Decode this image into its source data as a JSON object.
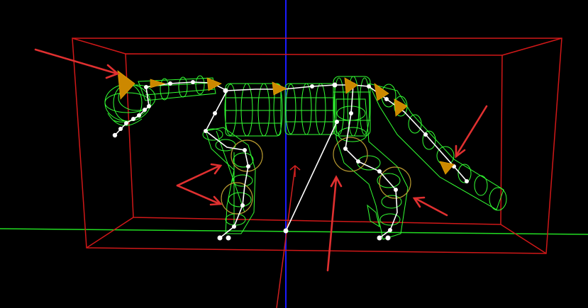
{
  "viewport": {
    "background": "#000000",
    "axis_colors": {
      "x": "#22dd22",
      "y": "#d02020",
      "z": "#1a1aff"
    },
    "bounding_box_color": "#d01818",
    "mesh_color": "#33ff33",
    "bone_color": "#ffffff",
    "joint_ring_color": "#b89a30",
    "cone_handle_color": "#cc8800",
    "annotation_arrow_color": "#e03030",
    "annotation_arrow_count": 7
  }
}
